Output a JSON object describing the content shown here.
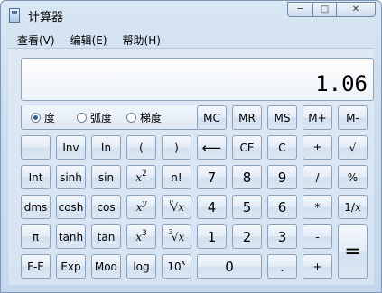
{
  "window": {
    "title": "计算器",
    "controls": {
      "minimize": "─",
      "maximize": "□",
      "close": "✕"
    }
  },
  "menu": [
    "查看(V)",
    "编辑(E)",
    "帮助(H)"
  ],
  "display": {
    "value": "1.06"
  },
  "angle_modes": [
    {
      "label": "度",
      "selected": true
    },
    {
      "label": "弧度",
      "selected": false
    },
    {
      "label": "梯度",
      "selected": false
    }
  ],
  "memory_buttons": [
    "MC",
    "MR",
    "MS",
    "M+",
    "M-"
  ],
  "buttons": {
    "inv": "Inv",
    "ln": "In",
    "lparen": "(",
    "rparen": ")",
    "backspace": "⟵",
    "ce": "CE",
    "c": "C",
    "plusminus": "±",
    "sqrt": "√",
    "int": "Int",
    "sinh": "sinh",
    "sin": "sin",
    "x2_base": "x",
    "x2_exp": "2",
    "nfact": "n!",
    "n7": "7",
    "n8": "8",
    "n9": "9",
    "div": "/",
    "pct": "%",
    "dms": "dms",
    "cosh": "cosh",
    "cos": "cos",
    "xy_base": "x",
    "xy_exp": "y",
    "yroot_idx": "y",
    "yroot_sym": "√",
    "yroot_x": "x",
    "n4": "4",
    "n5": "5",
    "n6": "6",
    "mul": "*",
    "recip_a": "1/",
    "recip_b": "x",
    "pi": "π",
    "tanh": "tanh",
    "tan": "tan",
    "x3_base": "x",
    "x3_exp": "3",
    "croot_idx": "3",
    "croot_sym": "√",
    "croot_x": "x",
    "n1": "1",
    "n2": "2",
    "n3": "3",
    "sub": "-",
    "eq": "=",
    "fe": "F-E",
    "exp": "Exp",
    "mod": "Mod",
    "log": "log",
    "tenx_base": "10",
    "tenx_exp": "x",
    "n0": "0",
    "dot": ".",
    "add": "+"
  }
}
